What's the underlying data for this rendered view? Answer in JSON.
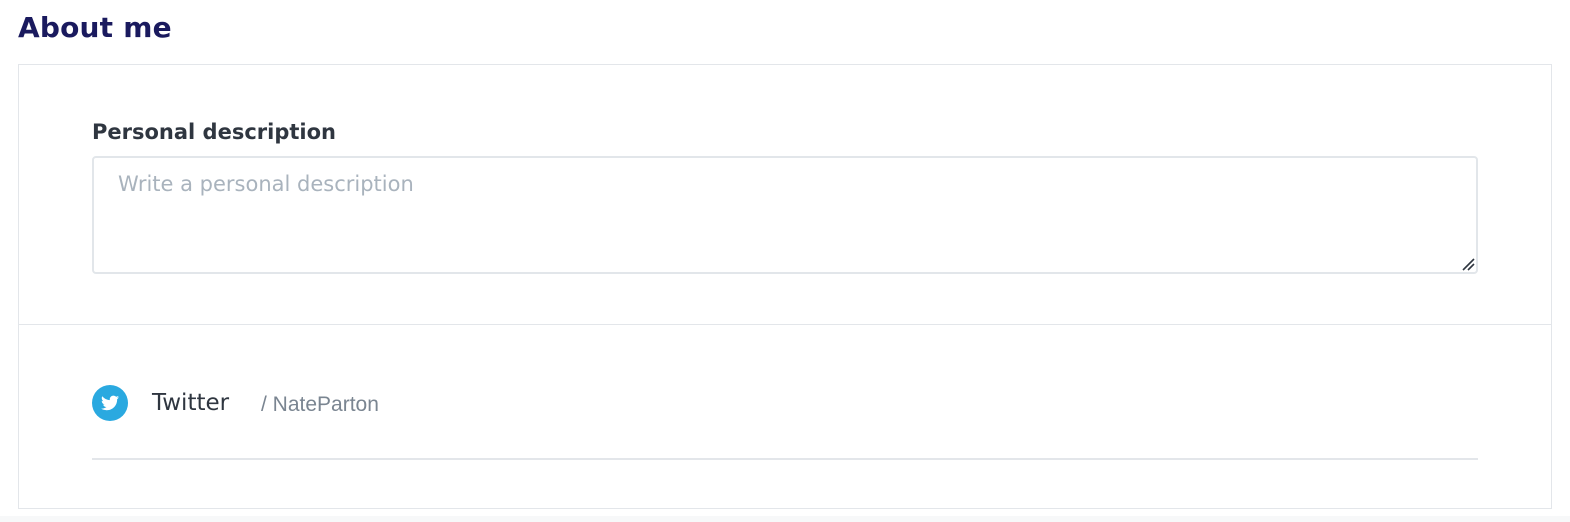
{
  "section": {
    "title": "About me"
  },
  "personal_description": {
    "label": "Personal description",
    "value": "",
    "placeholder": "Write a personal description"
  },
  "social_links": [
    {
      "network": "Twitter",
      "icon": "twitter-icon",
      "handle": "/ NateParton",
      "icon_color": "#2aa9e0"
    }
  ],
  "colors": {
    "title": "#1a1a5e",
    "text": "#2f3640",
    "placeholder": "#a9b3bd",
    "border": "#e3e6ea",
    "muted": "#7a8591"
  }
}
